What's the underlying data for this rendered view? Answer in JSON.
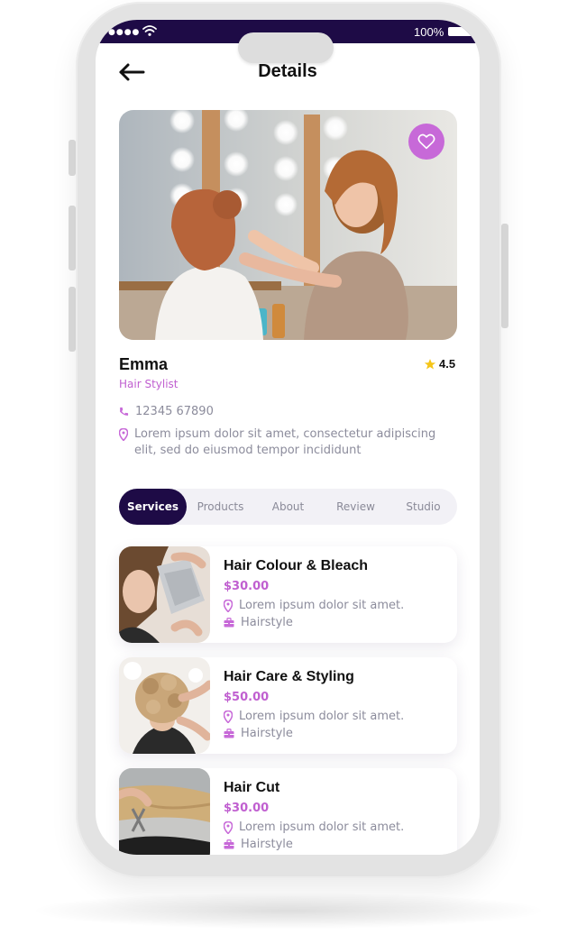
{
  "status_bar": {
    "battery": "100%"
  },
  "header": {
    "title": "Details",
    "back_icon": "arrow-left-icon"
  },
  "profile": {
    "name": "Emma",
    "role": "Hair Stylist",
    "rating": "4.5",
    "phone": "12345 67890",
    "address": "Lorem ipsum dolor sit amet, consectetur adipiscing elit, sed do eiusmod tempor incididunt",
    "favorite_icon": "heart-icon"
  },
  "tabs": [
    "Services",
    "Products",
    "About",
    "Review",
    "Studio"
  ],
  "active_tab": "Services",
  "services": [
    {
      "title": "Hair Colour & Bleach",
      "price": "$30.00",
      "location": "Lorem ipsum dolor sit amet.",
      "category": "Hairstyle"
    },
    {
      "title": "Hair Care & Styling",
      "price": "$50.00",
      "location": "Lorem ipsum dolor sit amet.",
      "category": "Hairstyle"
    },
    {
      "title": "Hair Cut",
      "price": "$30.00",
      "location": "Lorem ipsum dolor sit amet.",
      "category": "Hairstyle"
    }
  ],
  "colors": {
    "primary": "#1e0b46",
    "accent": "#c769d8",
    "text_muted": "#8c8c9c",
    "star": "#f5c518"
  }
}
